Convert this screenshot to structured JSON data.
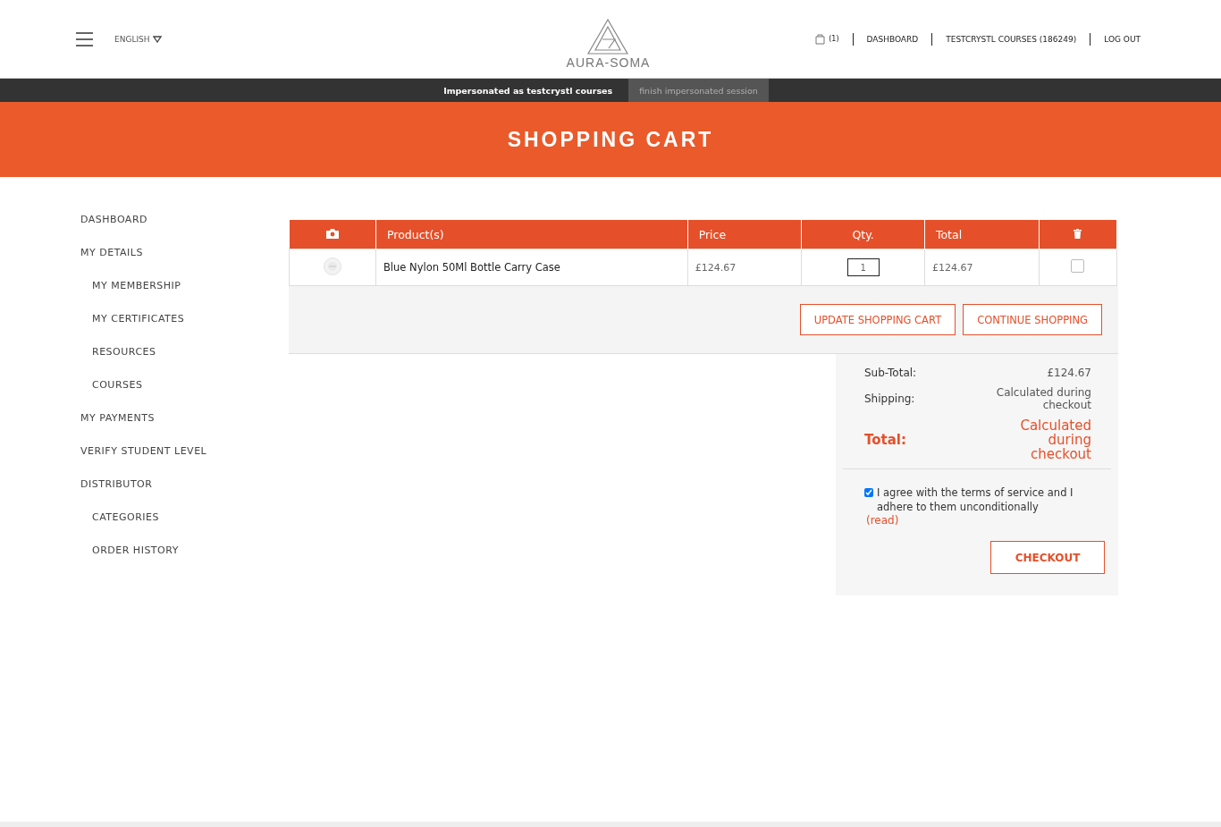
{
  "header": {
    "language": "ENGLISH",
    "logo_text": "AURA-SOMA",
    "cart_count": "(1)",
    "nav": [
      "DASHBOARD",
      "TESTCRYSTL COURSES (186249)",
      "LOG OUT"
    ]
  },
  "impersonation_bar": {
    "message": "Impersonated as testcrystl courses",
    "finish_button": "finish impersonated session"
  },
  "banner": {
    "title": "SHOPPING CART"
  },
  "sidebar": {
    "items": [
      {
        "label": "DASHBOARD"
      },
      {
        "label": "MY DETAILS",
        "children": [
          {
            "label": "MY MEMBERSHIP"
          },
          {
            "label": "MY CERTIFICATES"
          },
          {
            "label": "RESOURCES"
          },
          {
            "label": "COURSES"
          }
        ]
      },
      {
        "label": "MY PAYMENTS"
      },
      {
        "label": "VERIFY STUDENT LEVEL"
      },
      {
        "label": "DISTRIBUTOR",
        "children": [
          {
            "label": "CATEGORIES"
          },
          {
            "label": "ORDER HISTORY"
          }
        ]
      }
    ]
  },
  "cart_table": {
    "columns": [
      "Product(s)",
      "Price",
      "Qty.",
      "Total"
    ],
    "rows": [
      {
        "product": "Blue Nylon 50Ml Bottle Carry Case",
        "price": "£124.67",
        "qty": "1",
        "total": "£124.67",
        "selected": false
      }
    ]
  },
  "cart_buttons": [
    "UPDATE SHOPPING CART",
    "CONTINUE SHOPPING"
  ],
  "totals": {
    "subtotal_label": "Sub-Total:",
    "subtotal": "£124.67",
    "shipping_label": "Shipping:",
    "shipping": "Calculated during checkout",
    "total_label": "Total:",
    "total": "Calculated during checkout"
  },
  "terms": {
    "checked": true,
    "text": "I agree with the terms of service and I adhere to them unconditionally",
    "link": "(read)"
  },
  "checkout_button": "CHECKOUT"
}
